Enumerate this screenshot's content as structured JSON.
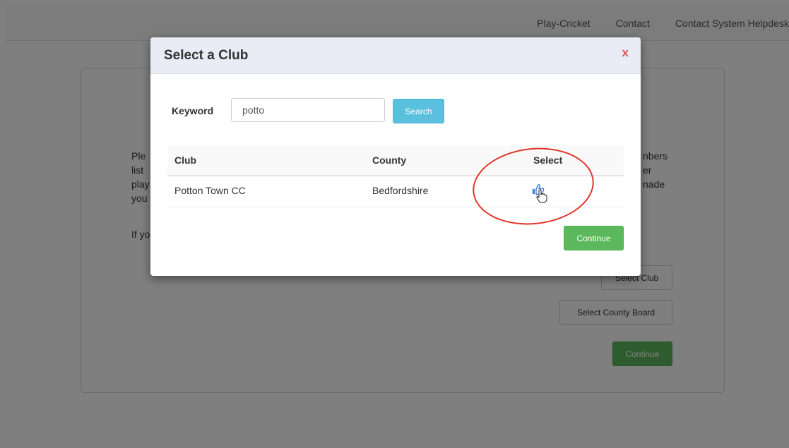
{
  "nav": {
    "links": [
      "Play-Cricket",
      "Contact",
      "Contact System Helpdesk"
    ]
  },
  "background": {
    "para_fragments": {
      "left": [
        "Ple",
        "list",
        "play",
        "you"
      ],
      "right": [
        "nbers",
        "er",
        "nade"
      ],
      "line2_left": "If yo"
    },
    "buttons": {
      "select_club": "Select Club",
      "select_county_board": "Select County Board",
      "continue": "Continue"
    }
  },
  "modal": {
    "title": "Select a Club",
    "close": "x",
    "keyword_label": "Keyword",
    "keyword_value": "potto",
    "search_label": "Search",
    "table": {
      "headers": [
        "Club",
        "County",
        "Select"
      ],
      "rows": [
        {
          "club": "Potton Town CC",
          "county": "Bedfordshire"
        }
      ]
    },
    "continue_label": "Continue"
  },
  "colors": {
    "search": "#5bc0de",
    "continue": "#5cb85c",
    "close": "#d9534f",
    "annotation": "#e0352b"
  },
  "icons": {
    "select": "thumbs-up-icon",
    "cursor": "hand-pointer-icon"
  }
}
